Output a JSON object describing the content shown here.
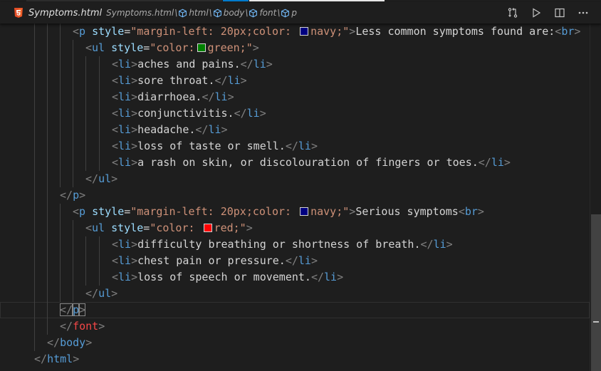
{
  "breadcrumb": {
    "file_name": "Symptoms.html",
    "crumbs": [
      {
        "label": "Symptoms.html",
        "icon": "none"
      },
      {
        "label": "html",
        "icon": "cube-icon"
      },
      {
        "label": "body",
        "icon": "cube-icon"
      },
      {
        "label": "font",
        "icon": "cube-icon"
      },
      {
        "label": "p",
        "icon": "cube-icon"
      }
    ],
    "separator": "\\"
  },
  "toolbar": {
    "buttons": [
      "open-changes-icon",
      "run-icon",
      "split-editor-icon",
      "more-actions-icon"
    ]
  },
  "colors": {
    "background": "#1e1e1e",
    "tag": "#569cd6",
    "attribute": "#9cdcfe",
    "string": "#ce9178",
    "deprecated_tag": "#f44747",
    "swatch_navy": "#000080",
    "swatch_green": "#008000",
    "swatch_red": "#ff0000"
  },
  "editor": {
    "current_line_index": 17,
    "lines": [
      {
        "indent": 6,
        "tokens": [
          [
            "b",
            "<"
          ],
          [
            "t",
            "p"
          ],
          [
            "x",
            " "
          ],
          [
            "a",
            "style"
          ],
          [
            "x",
            "="
          ],
          [
            "s",
            "\"margin-left: 20px;color: "
          ],
          [
            "sw",
            "#000080"
          ],
          [
            "s",
            "navy;\""
          ],
          [
            "b",
            ">"
          ],
          [
            "x",
            "Less common symptoms found are:"
          ],
          [
            "b",
            "<"
          ],
          [
            "t",
            "br"
          ],
          [
            "b",
            ">"
          ]
        ]
      },
      {
        "indent": 8,
        "tokens": [
          [
            "b",
            "<"
          ],
          [
            "t",
            "ul"
          ],
          [
            "x",
            " "
          ],
          [
            "a",
            "style"
          ],
          [
            "x",
            "="
          ],
          [
            "s",
            "\"color:"
          ],
          [
            "sw",
            "#008000"
          ],
          [
            "s",
            "green;\""
          ],
          [
            "b",
            ">"
          ]
        ]
      },
      {
        "indent": 12,
        "tokens": [
          [
            "b",
            "<"
          ],
          [
            "t",
            "li"
          ],
          [
            "b",
            ">"
          ],
          [
            "x",
            "aches and pains."
          ],
          [
            "b",
            "</"
          ],
          [
            "t",
            "li"
          ],
          [
            "b",
            ">"
          ]
        ]
      },
      {
        "indent": 12,
        "tokens": [
          [
            "b",
            "<"
          ],
          [
            "t",
            "li"
          ],
          [
            "b",
            ">"
          ],
          [
            "x",
            "sore throat."
          ],
          [
            "b",
            "</"
          ],
          [
            "t",
            "li"
          ],
          [
            "b",
            ">"
          ]
        ]
      },
      {
        "indent": 12,
        "tokens": [
          [
            "b",
            "<"
          ],
          [
            "t",
            "li"
          ],
          [
            "b",
            ">"
          ],
          [
            "x",
            "diarrhoea."
          ],
          [
            "b",
            "</"
          ],
          [
            "t",
            "li"
          ],
          [
            "b",
            ">"
          ]
        ]
      },
      {
        "indent": 12,
        "tokens": [
          [
            "b",
            "<"
          ],
          [
            "t",
            "li"
          ],
          [
            "b",
            ">"
          ],
          [
            "x",
            "conjunctivitis."
          ],
          [
            "b",
            "</"
          ],
          [
            "t",
            "li"
          ],
          [
            "b",
            ">"
          ]
        ]
      },
      {
        "indent": 12,
        "tokens": [
          [
            "b",
            "<"
          ],
          [
            "t",
            "li"
          ],
          [
            "b",
            ">"
          ],
          [
            "x",
            "headache."
          ],
          [
            "b",
            "</"
          ],
          [
            "t",
            "li"
          ],
          [
            "b",
            ">"
          ]
        ]
      },
      {
        "indent": 12,
        "tokens": [
          [
            "b",
            "<"
          ],
          [
            "t",
            "li"
          ],
          [
            "b",
            ">"
          ],
          [
            "x",
            "loss of taste or smell."
          ],
          [
            "b",
            "</"
          ],
          [
            "t",
            "li"
          ],
          [
            "b",
            ">"
          ]
        ]
      },
      {
        "indent": 12,
        "tokens": [
          [
            "b",
            "<"
          ],
          [
            "t",
            "li"
          ],
          [
            "b",
            ">"
          ],
          [
            "x",
            "a rash on skin, or discolouration of fingers or toes."
          ],
          [
            "b",
            "</"
          ],
          [
            "t",
            "li"
          ],
          [
            "b",
            ">"
          ]
        ]
      },
      {
        "indent": 8,
        "tokens": [
          [
            "b",
            "</"
          ],
          [
            "t",
            "ul"
          ],
          [
            "b",
            ">"
          ]
        ]
      },
      {
        "indent": 4,
        "tokens": [
          [
            "b",
            "</"
          ],
          [
            "t",
            "p"
          ],
          [
            "b",
            ">"
          ]
        ]
      },
      {
        "indent": 6,
        "tokens": [
          [
            "b",
            "<"
          ],
          [
            "t",
            "p"
          ],
          [
            "x",
            " "
          ],
          [
            "a",
            "style"
          ],
          [
            "x",
            "="
          ],
          [
            "s",
            "\"margin-left: 20px;color: "
          ],
          [
            "sw",
            "#000080"
          ],
          [
            "s",
            "navy;\""
          ],
          [
            "b",
            ">"
          ],
          [
            "x",
            "Serious symptoms"
          ],
          [
            "b",
            "<"
          ],
          [
            "t",
            "br"
          ],
          [
            "b",
            ">"
          ]
        ]
      },
      {
        "indent": 8,
        "tokens": [
          [
            "b",
            "<"
          ],
          [
            "t",
            "ul"
          ],
          [
            "x",
            " "
          ],
          [
            "a",
            "style"
          ],
          [
            "x",
            "="
          ],
          [
            "s",
            "\"color: "
          ],
          [
            "sw",
            "#ff0000"
          ],
          [
            "s",
            "red;\""
          ],
          [
            "b",
            ">"
          ]
        ]
      },
      {
        "indent": 12,
        "tokens": [
          [
            "b",
            "<"
          ],
          [
            "t",
            "li"
          ],
          [
            "b",
            ">"
          ],
          [
            "x",
            "difficulty breathing or shortness of breath."
          ],
          [
            "b",
            "</"
          ],
          [
            "t",
            "li"
          ],
          [
            "b",
            ">"
          ]
        ]
      },
      {
        "indent": 12,
        "tokens": [
          [
            "b",
            "<"
          ],
          [
            "t",
            "li"
          ],
          [
            "b",
            ">"
          ],
          [
            "x",
            "chest pain or pressure."
          ],
          [
            "b",
            "</"
          ],
          [
            "t",
            "li"
          ],
          [
            "b",
            ">"
          ]
        ]
      },
      {
        "indent": 12,
        "tokens": [
          [
            "b",
            "<"
          ],
          [
            "t",
            "li"
          ],
          [
            "b",
            ">"
          ],
          [
            "x",
            "loss of speech or movement."
          ],
          [
            "b",
            "</"
          ],
          [
            "t",
            "li"
          ],
          [
            "b",
            ">"
          ]
        ]
      },
      {
        "indent": 8,
        "tokens": [
          [
            "b",
            "</"
          ],
          [
            "t",
            "ul"
          ],
          [
            "b",
            ">"
          ]
        ]
      },
      {
        "indent": 4,
        "tokens": [
          [
            "m",
            "</"
          ],
          [
            "mt",
            "p"
          ],
          [
            "m",
            ">"
          ]
        ]
      },
      {
        "indent": 4,
        "tokens": [
          [
            "b",
            "</"
          ],
          [
            "r",
            "font"
          ],
          [
            "b",
            ">"
          ]
        ]
      },
      {
        "indent": 2,
        "tokens": [
          [
            "b",
            "</"
          ],
          [
            "t",
            "body"
          ],
          [
            "b",
            ">"
          ]
        ]
      },
      {
        "indent": 0,
        "tokens": [
          [
            "b",
            "</"
          ],
          [
            "t",
            "html"
          ],
          [
            "b",
            ">"
          ]
        ]
      }
    ]
  }
}
